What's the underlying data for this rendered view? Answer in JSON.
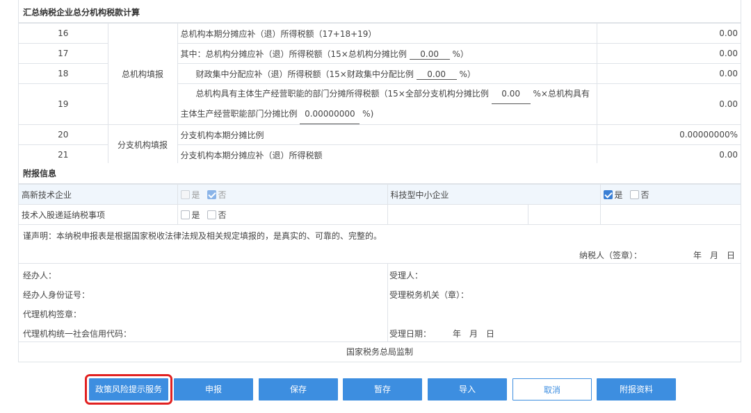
{
  "summary_section": {
    "title": "汇总纳税企业总分机构税款计算",
    "rows": [
      {
        "num": "16",
        "text": "总机构本期分摊应补（退）所得税额（17+18+19）",
        "amount": "0.00"
      },
      {
        "num": "17",
        "text_a": "其中：总机构分摊应补（退）所得税额（15×总机构分摊比例",
        "ratio": "0.00",
        "text_b": "%）",
        "amount": "0.00"
      },
      {
        "num": "18",
        "text_a": "财政集中分配应补（退）所得税额（15×财政集中分配比例",
        "ratio": "0.00",
        "text_b": "%）",
        "amount": "0.00"
      },
      {
        "num": "19",
        "text_a": "总机构具有主体生产经营职能的部门分摊所得税额（15×全部分支机构分摊比例",
        "ratio_a": "0.00",
        "text_b": "%×总机构具有",
        "text_c": "主体生产经营职能部门分摊比例",
        "ratio_b": "0.00000000",
        "text_d": "%)",
        "amount": "0.00"
      },
      {
        "num": "20",
        "text": "分支机构本期分摊比例",
        "amount": "0.00000000%"
      },
      {
        "num": "21",
        "text": "分支机构本期分摊应补（退）所得税额",
        "amount": "0.00"
      }
    ],
    "group_head_office": "总机构填报",
    "group_branch": "分支机构填报"
  },
  "attach_section": {
    "title": "附报信息",
    "high_tech_label": "高新技术企业",
    "tech_sme_label": "科技型中小企业",
    "tech_equity_label": "技术入股递延纳税事项",
    "yes": "是",
    "no": "否"
  },
  "declaration": {
    "statement": "谨声明：本纳税申报表是根据国家税收法律法规及相关规定填报的，是真实的、可靠的、完整的。",
    "taxpayer_sign": "纳税人（签章）：",
    "ymd": "年　月　日",
    "handler": "经办人：",
    "handler_id": "经办人身份证号：",
    "agency_seal": "代理机构签章：",
    "agency_code": "代理机构统一社会信用代码：",
    "receiver": "受理人：",
    "tax_office": "受理税务机关（章）：",
    "receive_date": "受理日期：",
    "receive_ymd": "年　月　日",
    "footer": "国家税务总局监制"
  },
  "buttons": {
    "policy_risk": "政策风险提示服务",
    "declare": "申报",
    "save": "保存",
    "temp_save": "暂存",
    "import": "导入",
    "cancel": "取消",
    "attachments": "附报资料"
  },
  "colors": {
    "accent": "#3d8ee0",
    "highlight": "#e12121"
  }
}
